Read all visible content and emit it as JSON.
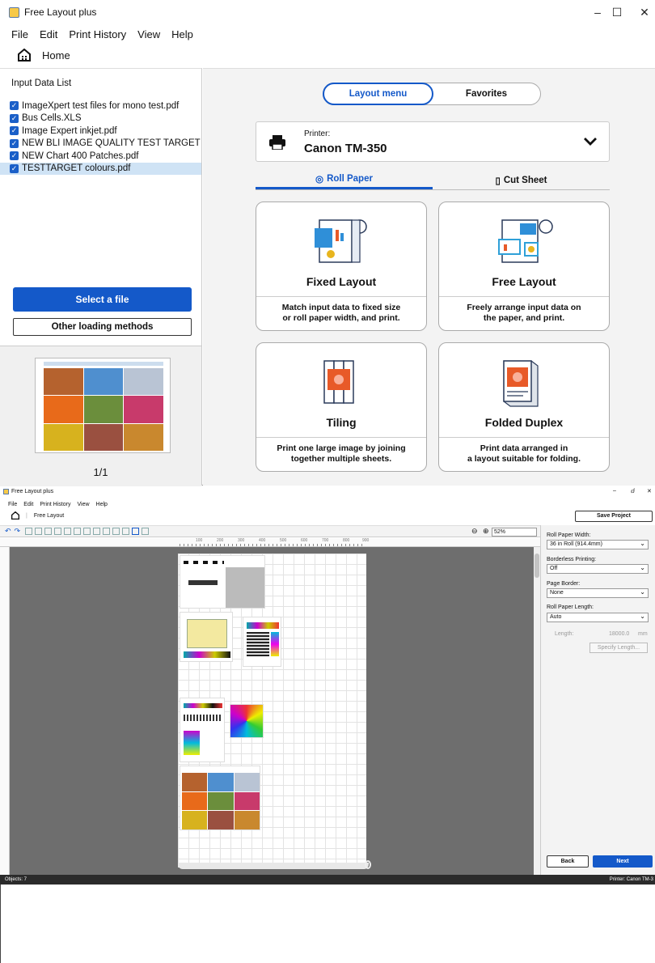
{
  "window1": {
    "title": "Free Layout plus",
    "menu": [
      "File",
      "Edit",
      "Print History",
      "View",
      "Help"
    ],
    "home_label": "Home",
    "input_list_title": "Input Data List",
    "files": [
      "ImageXpert test files for mono test.pdf",
      "Bus Cells.XLS",
      "Image Expert inkjet.pdf",
      "NEW BLI IMAGE QUALITY TEST TARGET wit...",
      "NEW Chart 400 Patches.pdf",
      "TESTTARGET colours.pdf"
    ],
    "select_file_label": "Select a file",
    "other_loading_label": "Other loading methods",
    "page_indicator": "1/1",
    "segment": {
      "layout_menu": "Layout menu",
      "favorites": "Favorites"
    },
    "printer": {
      "label": "Printer:",
      "name": "Canon TM-350"
    },
    "tabs": {
      "roll": "Roll Paper",
      "cut": "Cut Sheet"
    },
    "cards": [
      {
        "title": "Fixed Layout",
        "desc": "Match input data to fixed size\nor roll paper width, and print."
      },
      {
        "title": "Free Layout",
        "desc": "Freely arrange input data on\nthe paper, and print."
      },
      {
        "title": "Tiling",
        "desc": "Print one large image by joining\ntogether multiple sheets."
      },
      {
        "title": "Folded Duplex",
        "desc": "Print data arranged in\na layout suitable for folding."
      }
    ]
  },
  "window2": {
    "title": "Free Layout plus",
    "menu": [
      "File",
      "Edit",
      "Print History",
      "View",
      "Help"
    ],
    "breadcrumb_label": "Free Layout",
    "save_project_label": "Save Project",
    "zoom_value": "52%",
    "ruler_marks": [
      "100",
      "200",
      "300",
      "400",
      "500",
      "600",
      "700",
      "800",
      "900"
    ],
    "roll_width_label": "Roll Paper Width:",
    "roll_width_value": "36 in Roll (914.4mm)",
    "borderless_label": "Borderless Printing:",
    "borderless_value": "Off",
    "page_border_label": "Page Border:",
    "page_border_value": "None",
    "roll_length_label": "Roll Paper Length:",
    "roll_length_value": "Auto",
    "length_label": "Length:",
    "length_value": "18000.0",
    "length_unit": "mm",
    "specify_length_label": "Specify Length...",
    "back_label": "Back",
    "next_label": "Next",
    "status_objects": "Objects: 7",
    "status_printer": "Printer: Canon TM-3"
  }
}
